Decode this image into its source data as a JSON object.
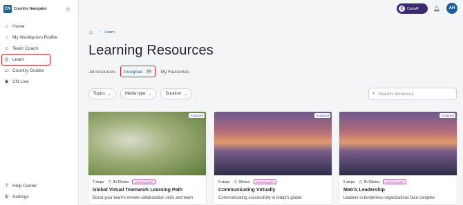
{
  "sidebar": {
    "brand_mark": "CN",
    "brand_name": "Country Navigator",
    "items": [
      {
        "label": "Home",
        "icon": "home-icon"
      },
      {
        "label": "My Worldprism Profile",
        "icon": "globe-icon"
      },
      {
        "label": "Team Coach",
        "icon": "team-icon"
      },
      {
        "label": "Learn",
        "icon": "learn-icon"
      },
      {
        "label": "Country Guides",
        "icon": "guide-icon"
      },
      {
        "label": "CN Live",
        "icon": "live-icon"
      }
    ],
    "bottom": [
      {
        "label": "Help Center",
        "icon": "help-icon"
      },
      {
        "label": "Settings",
        "icon": "settings-icon"
      }
    ]
  },
  "topbar": {
    "assistant_label": "CarlaAI",
    "avatar_initials": "AH"
  },
  "breadcrumb": {
    "current": "Learn"
  },
  "page": {
    "title": "Learning Resources"
  },
  "tabs": [
    {
      "label": "All resources"
    },
    {
      "label": "Assigned",
      "count": "29"
    },
    {
      "label": "My Favourites"
    }
  ],
  "filters": [
    {
      "label": "Topics"
    },
    {
      "label": "Media type"
    },
    {
      "label": "Duration"
    }
  ],
  "search": {
    "placeholder": "Search resources"
  },
  "cards": [
    {
      "badge": "Assigned",
      "steps": "7 steps",
      "duration": "3h 15mins",
      "type": "Learning path",
      "title": "Global Virtual Teamwork Learning Path",
      "desc": "Boost your team's remote collaboration skills and learn"
    },
    {
      "badge": "Assigned",
      "steps": "6 steps",
      "duration": "39mins",
      "type": "Learning path",
      "title": "Communicating Virtually",
      "desc": "Communicating successfully in today's global"
    },
    {
      "badge": "Assigned",
      "steps": "5 steps",
      "duration": "2h 53mins",
      "type": "Learning path",
      "title": "Matrix Leadership",
      "desc": "Leaders in borderless organizations face complex"
    }
  ],
  "colors": {
    "brand": "#1b5f98",
    "highlight": "#d9252a",
    "assistant": "#3a2a6e",
    "learning_path": "#b04aa8"
  }
}
